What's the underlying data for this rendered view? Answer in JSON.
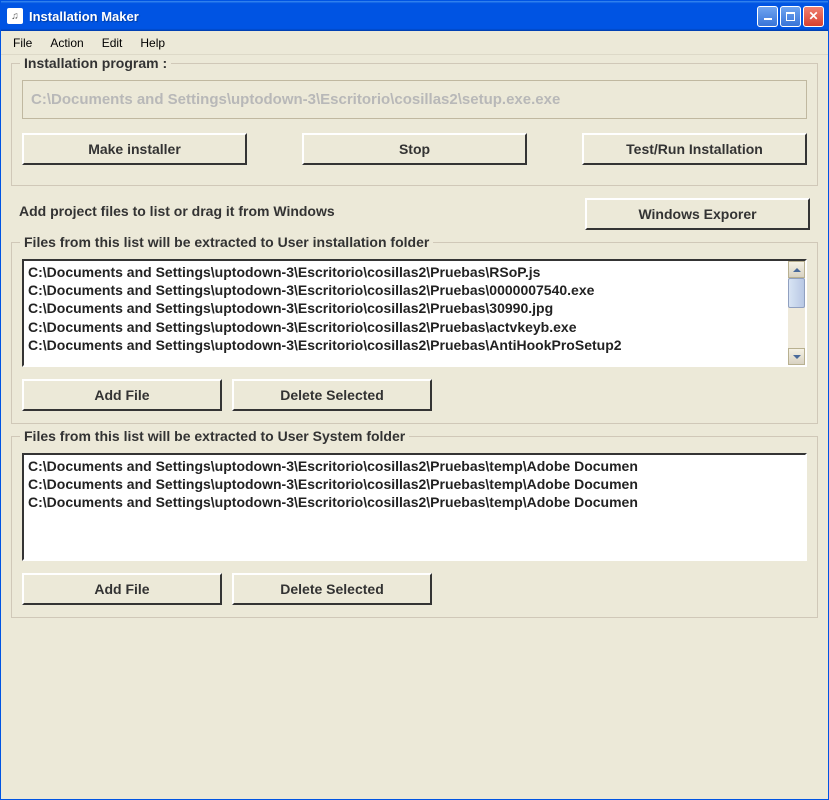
{
  "window": {
    "title": "Installation Maker"
  },
  "menu": {
    "file": "File",
    "action": "Action",
    "edit": "Edit",
    "help": "Help"
  },
  "group1": {
    "title": "Installation program :",
    "path": "C:\\Documents and Settings\\uptodown-3\\Escritorio\\cosillas2\\setup.exe.exe",
    "make": "Make installer",
    "stop": "Stop",
    "test": "Test/Run Installation"
  },
  "mid": {
    "label": "Add project files to list or drag it from Windows",
    "explorer": "Windows Exporer"
  },
  "group2": {
    "title": "Files from this list will be extracted to User installation folder",
    "items": [
      "C:\\Documents and Settings\\uptodown-3\\Escritorio\\cosillas2\\Pruebas\\RSoP.js",
      "C:\\Documents and Settings\\uptodown-3\\Escritorio\\cosillas2\\Pruebas\\0000007540.exe",
      "C:\\Documents and Settings\\uptodown-3\\Escritorio\\cosillas2\\Pruebas\\30990.jpg",
      "C:\\Documents and Settings\\uptodown-3\\Escritorio\\cosillas2\\Pruebas\\actvkeyb.exe",
      "C:\\Documents and Settings\\uptodown-3\\Escritorio\\cosillas2\\Pruebas\\AntiHookProSetup2"
    ],
    "add": "Add File",
    "del": "Delete Selected"
  },
  "group3": {
    "title": "Files from this list will be extracted to User System folder",
    "items": [
      "C:\\Documents and Settings\\uptodown-3\\Escritorio\\cosillas2\\Pruebas\\temp\\Adobe Documen",
      "C:\\Documents and Settings\\uptodown-3\\Escritorio\\cosillas2\\Pruebas\\temp\\Adobe Documen",
      "C:\\Documents and Settings\\uptodown-3\\Escritorio\\cosillas2\\Pruebas\\temp\\Adobe Documen"
    ],
    "add": "Add File",
    "del": "Delete Selected"
  }
}
